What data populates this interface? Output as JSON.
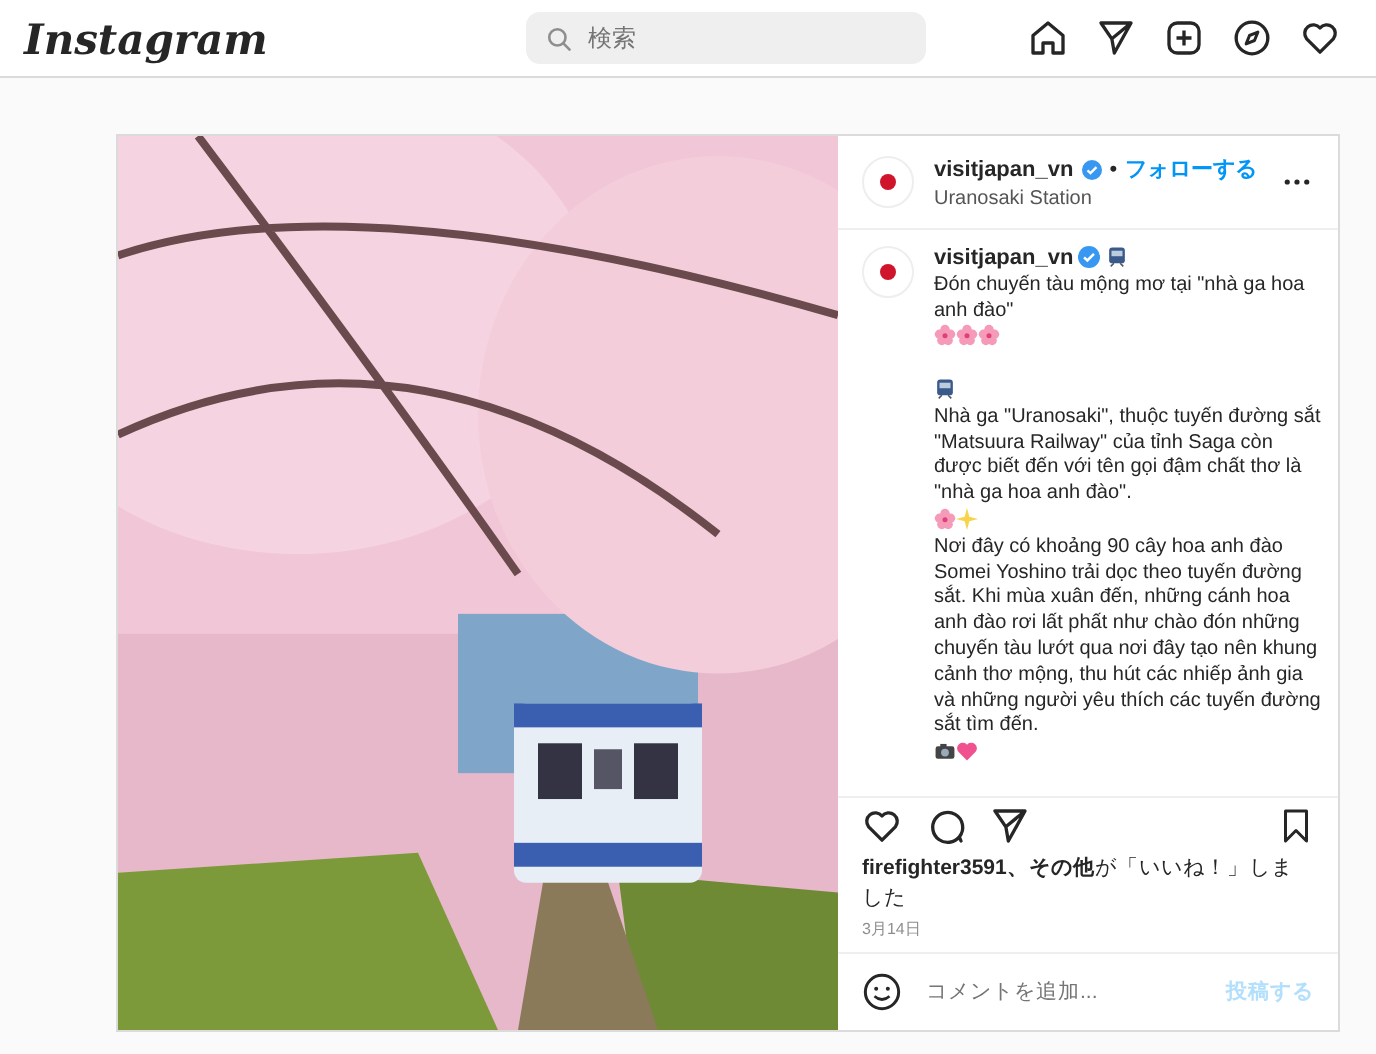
{
  "top_bar": {
    "logo": "Instagram",
    "search": {
      "placeholder": "検索"
    }
  },
  "post": {
    "account": "visitjapan_vn",
    "verified": true,
    "follow_label": "フォローする",
    "separator": "•",
    "location": "Uranosaki Station",
    "caption": {
      "account": "visitjapan_vn",
      "parts": [
        {
          "kind": "train"
        },
        {
          "kind": "text",
          "text": "Đón chuyến tàu mộng mơ tại \"nhà ga hoa anh đào\""
        },
        {
          "kind": "flower"
        },
        {
          "kind": "flower"
        },
        {
          "kind": "flower"
        },
        {
          "kind": "break"
        },
        {
          "kind": "break"
        },
        {
          "kind": "train"
        },
        {
          "kind": "text",
          "text": "Nhà ga \"Uranosaki\", thuộc tuyến đường sắt \"Matsuura Railway\" của tỉnh Saga còn được biết đến với tên gọi đậm chất thơ là \"nhà ga hoa anh đào\"."
        },
        {
          "kind": "flower"
        },
        {
          "kind": "sparkle"
        },
        {
          "kind": "text",
          "text": "Nơi đây có khoảng 90 cây hoa anh đào Somei Yoshino trải dọc theo tuyến đường sắt. Khi mùa xuân đến, những cánh hoa anh đào rơi lất phất như chào đón những chuyến tàu lướt qua nơi đây tạo nên khung cảnh thơ mộng, thu hút các nhiếp ảnh gia và những người yêu thích các tuyến đường sắt tìm đến."
        },
        {
          "kind": "camera"
        },
        {
          "kind": "heart"
        }
      ]
    },
    "liked": false,
    "saved": false,
    "likes": {
      "user": "firefighter3591",
      "rest_bold": "、その他",
      "rest": "が「いいね！」しました"
    },
    "date": "3月14日",
    "comment": {
      "placeholder": "コメントを追加...",
      "post_label": "投稿する",
      "post_enabled": false
    }
  }
}
